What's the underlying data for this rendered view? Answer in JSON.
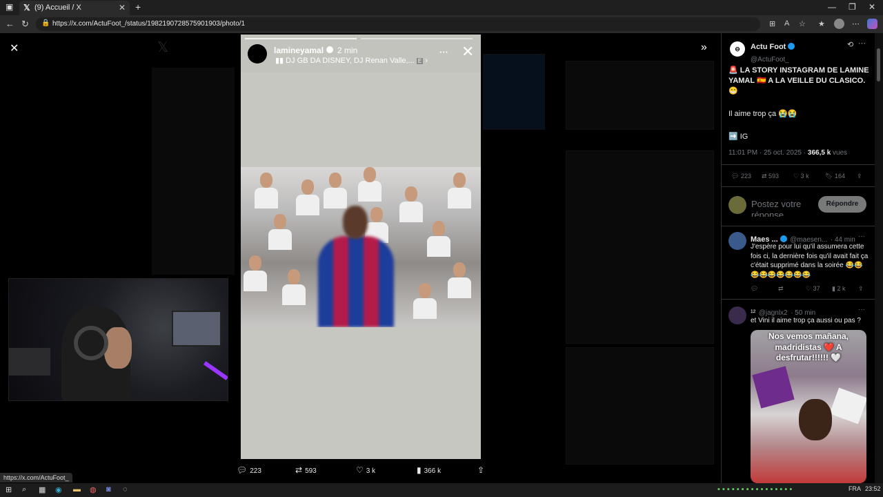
{
  "browser": {
    "tab_title": "(9) Accueil / X",
    "url": "https://x.com/ActuFoot_/status/1982190728575901903/photo/1",
    "status_link": "https://x.com/ActuFoot_"
  },
  "story": {
    "username": "lamineyamal",
    "time": "2 min",
    "music": "DJ GB DA DISNEY, DJ Renan Valle,...",
    "music_suffix": "E",
    "actions": {
      "replies": "223",
      "reposts": "593",
      "likes": "3 k",
      "views": "366 k"
    }
  },
  "tweet": {
    "author_name": "Actu Foot",
    "author_handle": "@ActuFoot_",
    "text_line1": "🚨 LA STORY INSTAGRAM DE LAMINE YAMAL 🇪🇸 A LA VEILLE DU CLASICO. 😁",
    "text_line2": "Il aime trop ça 😭😭",
    "text_line3": "➡️ IG",
    "timestamp": "11:01 PM · 25 oct. 2025 · ",
    "views_count": "366,5 k",
    "views_label": " vues",
    "replies": "223",
    "reposts": "593",
    "likes": "3 k",
    "bookmarks": "164",
    "reply_placeholder": "Postez votre réponse",
    "reply_button": "Répondre"
  },
  "replies": [
    {
      "name": "Maes ...",
      "handle": "@maesen...",
      "time": "· 44 min",
      "text": "J'espère pour lui qu'il assumera cette fois ci, la dernière fois qu'il avait fait ça c'était supprimé dans la soirée 😂😂😂😂😂😂😂😂😂",
      "likes": "37",
      "views": "2 k"
    },
    {
      "name": "¹²",
      "handle": "@jagnlx2",
      "time": "· 50 min",
      "text": "et Vini il aime trop ça aussi ou pas ?",
      "image_caption": "Nos vemos mañana, madridistas ❤️ A desfrutar!!!!!! 🤍"
    }
  ],
  "taskbar": {
    "lang": "FRA",
    "clock": "23:52"
  }
}
